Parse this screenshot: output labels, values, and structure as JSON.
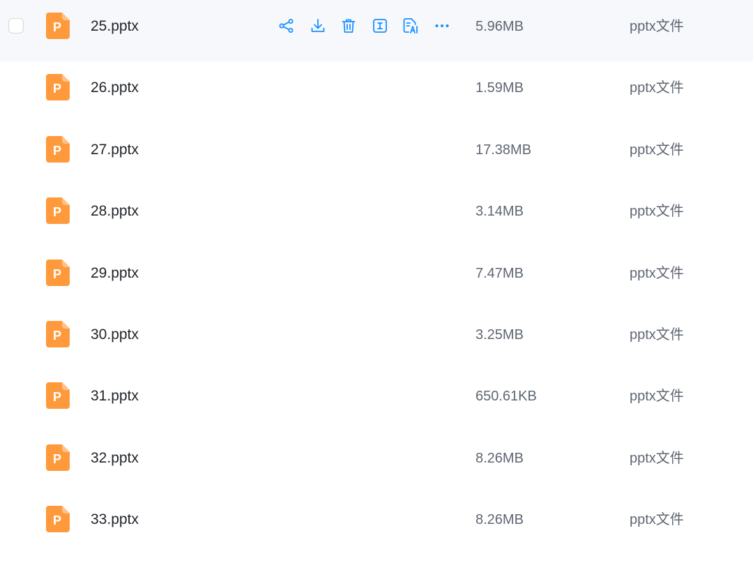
{
  "accent_color": "#1890ff",
  "file_icon_color": "#ff9a3c",
  "file_icon_letter": "P",
  "hover_actions": [
    "share-icon",
    "download-icon",
    "delete-icon",
    "rename-icon",
    "ai-summary-icon",
    "more-icon"
  ],
  "files": [
    {
      "name": "25.pptx",
      "size": "5.96MB",
      "type": "pptx文件",
      "hovered": true
    },
    {
      "name": "26.pptx",
      "size": "1.59MB",
      "type": "pptx文件"
    },
    {
      "name": "27.pptx",
      "size": "17.38MB",
      "type": "pptx文件"
    },
    {
      "name": "28.pptx",
      "size": "3.14MB",
      "type": "pptx文件"
    },
    {
      "name": "29.pptx",
      "size": "7.47MB",
      "type": "pptx文件"
    },
    {
      "name": "30.pptx",
      "size": "3.25MB",
      "type": "pptx文件"
    },
    {
      "name": "31.pptx",
      "size": "650.61KB",
      "type": "pptx文件"
    },
    {
      "name": "32.pptx",
      "size": "8.26MB",
      "type": "pptx文件"
    },
    {
      "name": "33.pptx",
      "size": "8.26MB",
      "type": "pptx文件"
    }
  ]
}
